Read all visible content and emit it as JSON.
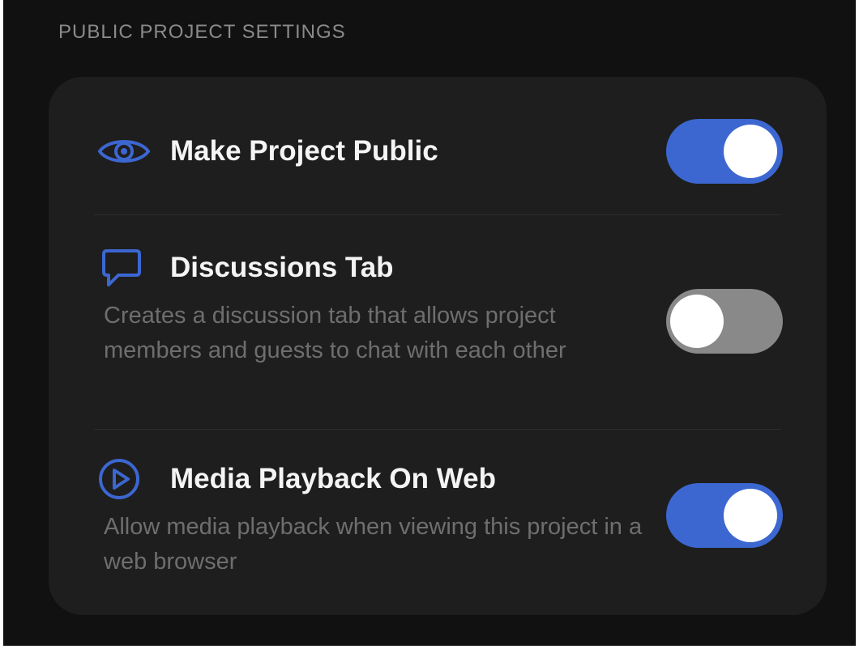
{
  "section": {
    "title": "PUBLIC PROJECT SETTINGS"
  },
  "colors": {
    "accent": "#3c67d1",
    "toggle_off": "#898989",
    "card": "#1e1e1e",
    "background": "#111111"
  },
  "settings": [
    {
      "icon": "eye-icon",
      "title": "Make Project Public",
      "description": "",
      "enabled": true
    },
    {
      "icon": "chat-bubble-icon",
      "title": "Discussions Tab",
      "description": "Creates a discussion tab that allows project members and guests to chat with each other",
      "enabled": false
    },
    {
      "icon": "play-circle-icon",
      "title": "Media Playback On Web",
      "description": "Allow media playback when viewing this project in a web browser",
      "enabled": true
    }
  ]
}
